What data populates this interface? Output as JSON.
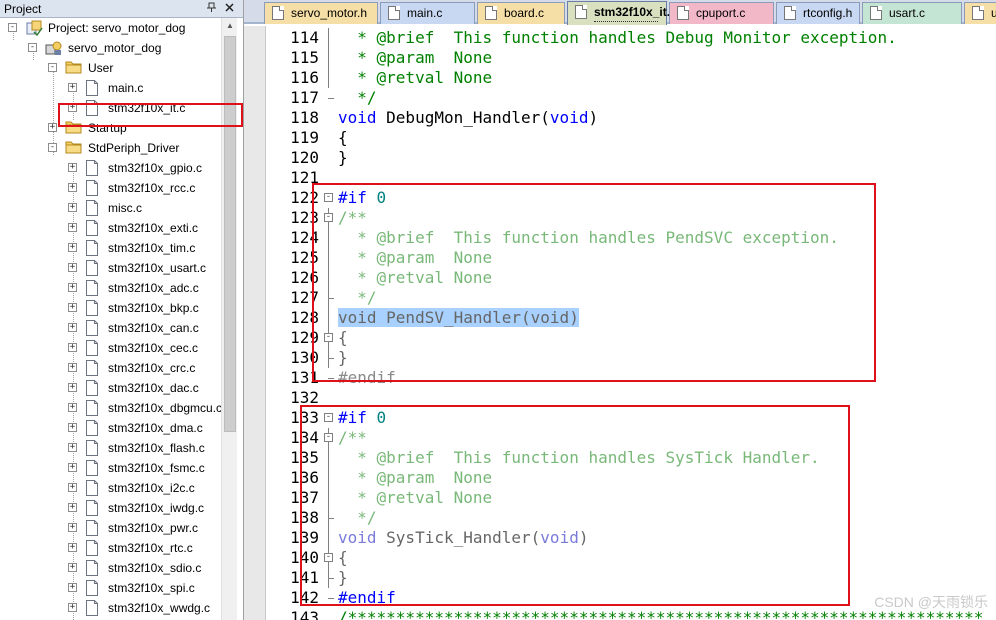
{
  "project_panel": {
    "title": "Project",
    "pin_icon": "pin-icon",
    "close_icon": "close-icon",
    "tree": [
      {
        "label": "Project: servo_motor_dog",
        "icon": "project-icon"
      },
      {
        "label": "servo_motor_dog",
        "icon": "target-icon"
      },
      {
        "label": "User",
        "icon": "folder-icon"
      },
      {
        "label": "main.c",
        "icon": "file-icon"
      },
      {
        "label": "stm32f10x_it.c",
        "icon": "file-icon"
      },
      {
        "label": "Startup",
        "icon": "folder-icon"
      },
      {
        "label": "StdPeriph_Driver",
        "icon": "folder-icon"
      },
      {
        "label": "stm32f10x_gpio.c",
        "icon": "file-icon"
      },
      {
        "label": "stm32f10x_rcc.c",
        "icon": "file-icon"
      },
      {
        "label": "misc.c",
        "icon": "file-icon"
      },
      {
        "label": "stm32f10x_exti.c",
        "icon": "file-icon"
      },
      {
        "label": "stm32f10x_tim.c",
        "icon": "file-icon"
      },
      {
        "label": "stm32f10x_usart.c",
        "icon": "file-icon"
      },
      {
        "label": "stm32f10x_adc.c",
        "icon": "file-icon"
      },
      {
        "label": "stm32f10x_bkp.c",
        "icon": "file-icon"
      },
      {
        "label": "stm32f10x_can.c",
        "icon": "file-icon"
      },
      {
        "label": "stm32f10x_cec.c",
        "icon": "file-icon"
      },
      {
        "label": "stm32f10x_crc.c",
        "icon": "file-icon"
      },
      {
        "label": "stm32f10x_dac.c",
        "icon": "file-icon"
      },
      {
        "label": "stm32f10x_dbgmcu.c",
        "icon": "file-icon"
      },
      {
        "label": "stm32f10x_dma.c",
        "icon": "file-icon"
      },
      {
        "label": "stm32f10x_flash.c",
        "icon": "file-icon"
      },
      {
        "label": "stm32f10x_fsmc.c",
        "icon": "file-icon"
      },
      {
        "label": "stm32f10x_i2c.c",
        "icon": "file-icon"
      },
      {
        "label": "stm32f10x_iwdg.c",
        "icon": "file-icon"
      },
      {
        "label": "stm32f10x_pwr.c",
        "icon": "file-icon"
      },
      {
        "label": "stm32f10x_rtc.c",
        "icon": "file-icon"
      },
      {
        "label": "stm32f10x_sdio.c",
        "icon": "file-icon"
      },
      {
        "label": "stm32f10x_spi.c",
        "icon": "file-icon"
      },
      {
        "label": "stm32f10x_wwdg.c",
        "icon": "file-icon"
      }
    ]
  },
  "editor": {
    "tabs": [
      {
        "label": "servo_motor.h",
        "color": "#f6dfa6",
        "active": false
      },
      {
        "label": "main.c",
        "color": "#c9d8f2",
        "active": false
      },
      {
        "label": "board.c",
        "color": "#f6dfa6",
        "active": false
      },
      {
        "label": "stm32f10x_it.c",
        "color": "#d8e0c0",
        "active": true
      },
      {
        "label": "cpuport.c",
        "color": "#f2b8c8",
        "active": false
      },
      {
        "label": "rtconfig.h",
        "color": "#c9d8f2",
        "active": false
      },
      {
        "label": "usart.c",
        "color": "#c4e4d4",
        "active": false
      },
      {
        "label": "usart.h",
        "color": "#f6dfa6",
        "active": false
      }
    ],
    "lines": [
      {
        "n": "114",
        "dim": false,
        "segs": [
          {
            "t": "  * @brief  This function handles Debug Monitor exception.",
            "c": "comment"
          }
        ]
      },
      {
        "n": "115",
        "dim": false,
        "segs": [
          {
            "t": "  * @param  None",
            "c": "comment"
          }
        ]
      },
      {
        "n": "116",
        "dim": false,
        "segs": [
          {
            "t": "  * @retval None",
            "c": "comment"
          }
        ]
      },
      {
        "n": "117",
        "dim": false,
        "segs": [
          {
            "t": "  */",
            "c": "comment"
          }
        ]
      },
      {
        "n": "118",
        "dim": false,
        "segs": [
          {
            "t": "void",
            "c": "keyword"
          },
          {
            "t": " DebugMon_Handler(",
            "c": "plain"
          },
          {
            "t": "void",
            "c": "keyword"
          },
          {
            "t": ")",
            "c": "plain"
          }
        ]
      },
      {
        "n": "119",
        "dim": false,
        "segs": [
          {
            "t": "{",
            "c": "plain"
          }
        ]
      },
      {
        "n": "120",
        "dim": false,
        "segs": [
          {
            "t": "}",
            "c": "plain"
          }
        ]
      },
      {
        "n": "121",
        "dim": false,
        "segs": [
          {
            "t": "",
            "c": "plain"
          }
        ]
      },
      {
        "n": "122",
        "dim": false,
        "segs": [
          {
            "t": "#if",
            "c": "directive"
          },
          {
            "t": " ",
            "c": "plain"
          },
          {
            "t": "0",
            "c": "number"
          }
        ]
      },
      {
        "n": "123",
        "dim": true,
        "segs": [
          {
            "t": "/**",
            "c": "comment"
          }
        ]
      },
      {
        "n": "124",
        "dim": true,
        "segs": [
          {
            "t": "  * @brief  This function handles PendSVC exception.",
            "c": "comment"
          }
        ]
      },
      {
        "n": "125",
        "dim": true,
        "segs": [
          {
            "t": "  * @param  None",
            "c": "comment"
          }
        ]
      },
      {
        "n": "126",
        "dim": true,
        "segs": [
          {
            "t": "  * @retval None",
            "c": "comment"
          }
        ]
      },
      {
        "n": "127",
        "dim": true,
        "segs": [
          {
            "t": "  */",
            "c": "comment"
          }
        ]
      },
      {
        "n": "128",
        "dim": true,
        "sel": true,
        "segs": [
          {
            "t": "void PendSV_Handler(void)",
            "c": "plain"
          }
        ]
      },
      {
        "n": "129",
        "dim": true,
        "segs": [
          {
            "t": "{",
            "c": "plain"
          }
        ]
      },
      {
        "n": "130",
        "dim": true,
        "segs": [
          {
            "t": "}",
            "c": "plain"
          }
        ]
      },
      {
        "n": "131",
        "dim": true,
        "segs": [
          {
            "t": "#endif",
            "c": "directive"
          }
        ]
      },
      {
        "n": "132",
        "dim": false,
        "segs": [
          {
            "t": "",
            "c": "plain"
          }
        ]
      },
      {
        "n": "133",
        "dim": false,
        "segs": [
          {
            "t": "#if",
            "c": "directive"
          },
          {
            "t": " ",
            "c": "plain"
          },
          {
            "t": "0",
            "c": "number"
          }
        ]
      },
      {
        "n": "134",
        "dim": true,
        "segs": [
          {
            "t": "/**",
            "c": "comment"
          }
        ]
      },
      {
        "n": "135",
        "dim": true,
        "segs": [
          {
            "t": "  * @brief  This function handles SysTick Handler.",
            "c": "comment"
          }
        ]
      },
      {
        "n": "136",
        "dim": true,
        "segs": [
          {
            "t": "  * @param  None",
            "c": "comment"
          }
        ]
      },
      {
        "n": "137",
        "dim": true,
        "segs": [
          {
            "t": "  * @retval None",
            "c": "comment"
          }
        ]
      },
      {
        "n": "138",
        "dim": true,
        "segs": [
          {
            "t": "  */",
            "c": "comment"
          }
        ]
      },
      {
        "n": "139",
        "dim": true,
        "segs": [
          {
            "t": "void",
            "c": "keyword"
          },
          {
            "t": " SysTick_Handler(",
            "c": "plain"
          },
          {
            "t": "void",
            "c": "keyword"
          },
          {
            "t": ")",
            "c": "plain"
          }
        ]
      },
      {
        "n": "140",
        "dim": true,
        "segs": [
          {
            "t": "{",
            "c": "plain"
          }
        ]
      },
      {
        "n": "141",
        "dim": true,
        "segs": [
          {
            "t": "}",
            "c": "plain"
          }
        ]
      },
      {
        "n": "142",
        "dim": false,
        "segs": [
          {
            "t": "#endif",
            "c": "directive"
          }
        ]
      },
      {
        "n": "143",
        "dim": false,
        "segs": [
          {
            "t": "/******************************************************************",
            "c": "comment"
          }
        ]
      }
    ]
  },
  "watermark": "CSDN @天雨锁乐"
}
